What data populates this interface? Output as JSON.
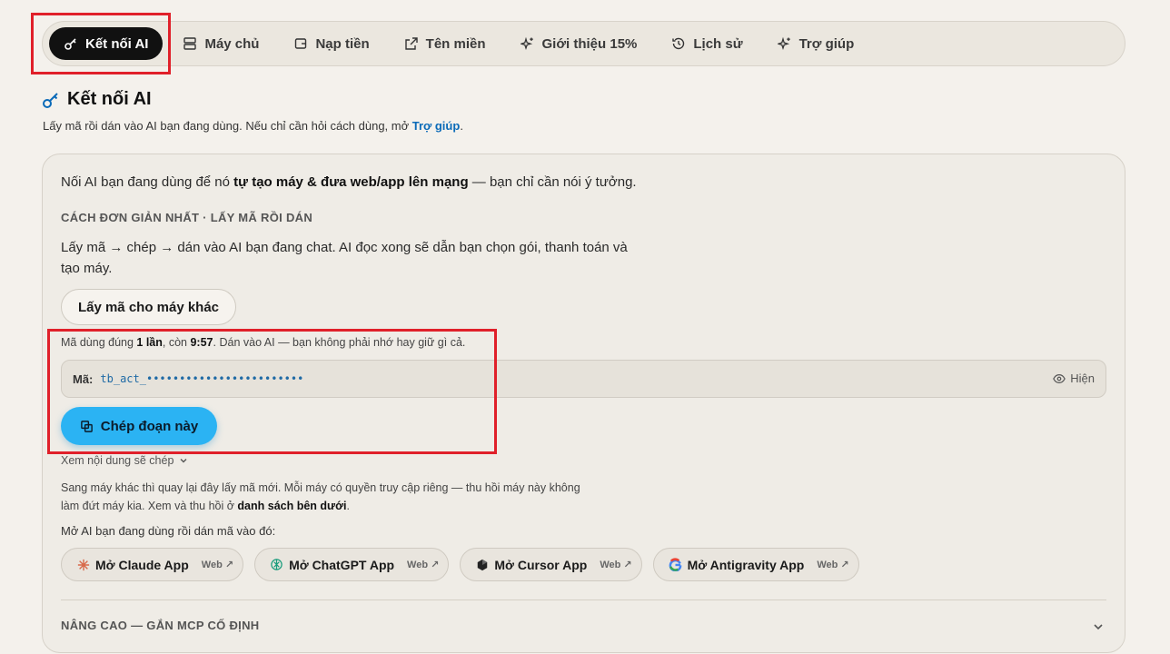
{
  "nav": {
    "items": [
      {
        "label": "Kết nối AI",
        "icon": "key-icon",
        "active": true
      },
      {
        "label": "Máy chủ",
        "icon": "server-icon"
      },
      {
        "label": "Nạp tiền",
        "icon": "wallet-icon"
      },
      {
        "label": "Tên miền",
        "icon": "external-link-icon"
      },
      {
        "label": "Giới thiệu 15%",
        "icon": "sparkles-icon"
      },
      {
        "label": "Lịch sử",
        "icon": "history-icon"
      },
      {
        "label": "Trợ giúp",
        "icon": "sparkles-icon"
      }
    ]
  },
  "page": {
    "title": "Kết nối AI",
    "subtitle_prefix": "Lấy mã rồi dán vào AI bạn đang dùng. Nếu chỉ cần hỏi cách dùng, mở ",
    "subtitle_link": "Trợ giúp",
    "subtitle_suffix": "."
  },
  "card": {
    "intro_prefix": "Nối AI bạn đang dùng để nó ",
    "intro_bold": "tự tạo máy & đưa web/app lên mạng",
    "intro_suffix": " — bạn chỉ cần nói ý tưởng.",
    "kicker": "CÁCH ĐƠN GIẢN NHẤT · LẤY MÃ RỒI DÁN",
    "steps": "Lấy mã → chép → dán vào AI bạn đang chat. AI đọc xong sẽ dẫn bạn chọn gói, thanh toán và tạo máy.",
    "other_button": "Lấy mã cho máy khác",
    "note_prefix": "Mã dùng đúng ",
    "note_bold1": "1 lần",
    "note_mid": ", còn ",
    "note_bold2": "9:57",
    "note_suffix": ". Dán vào AI — bạn không phải nhớ hay giữ gì cả.",
    "code_label": "Mã:",
    "code_value": "tb_act_••••••••••••••••••••••••",
    "show_label": "Hiện",
    "copy_button": "Chép đoạn này",
    "toggle_label": "Xem nội dung sẽ chép",
    "info_prefix": "Sang máy khác thì quay lại đây lấy mã mới. Mỗi máy có quyền truy cập riêng — thu hồi máy này không làm đứt máy kia. Xem và thu hồi ở ",
    "info_bold": "danh sách bên dưới",
    "info_suffix": ".",
    "open_prompt": "Mở AI bạn đang dùng rồi dán mã vào đó:",
    "apps": [
      {
        "name": "Mở Claude App",
        "web": "Web ↗",
        "icon": "claude-icon"
      },
      {
        "name": "Mở ChatGPT App",
        "web": "Web ↗",
        "icon": "chatgpt-icon"
      },
      {
        "name": "Mở Cursor App",
        "web": "Web ↗",
        "icon": "cursor-icon"
      },
      {
        "name": "Mở Antigravity App",
        "web": "Web ↗",
        "icon": "google-icon"
      }
    ],
    "advanced": "NÂNG CAO — GẮN MCP CỐ ĐỊNH"
  },
  "colors": {
    "accent": "#2bb3f3",
    "link": "#0a6ab8",
    "highlight": "#e0202a"
  }
}
